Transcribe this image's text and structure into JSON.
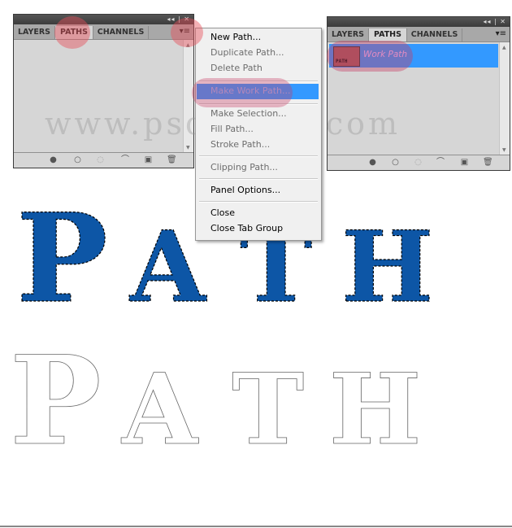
{
  "watermark": "www.psd-dude.com",
  "panel_left": {
    "window_controls": "◂◂ | ✕",
    "tabs": [
      {
        "label": "LAYERS",
        "active": false
      },
      {
        "label": "PATHS",
        "active": true
      },
      {
        "label": "CHANNELS",
        "active": false
      }
    ],
    "menu_icon": "▾≡",
    "footer_icons": [
      "fill-path-icon",
      "stroke-path-icon",
      "load-selection-icon",
      "make-work-path-icon",
      "new-path-icon",
      "delete-path-icon"
    ]
  },
  "context_menu": {
    "items": [
      {
        "label": "New Path...",
        "enabled": true
      },
      {
        "label": "Duplicate Path...",
        "enabled": false
      },
      {
        "label": "Delete Path",
        "enabled": false
      },
      {
        "label": "Make Work Path...",
        "enabled": false,
        "highlighted": true
      },
      {
        "label": "Make Selection...",
        "enabled": false
      },
      {
        "label": "Fill Path...",
        "enabled": false
      },
      {
        "label": "Stroke Path...",
        "enabled": false
      },
      {
        "label": "Clipping Path...",
        "enabled": false
      },
      {
        "label": "Panel Options...",
        "enabled": true
      },
      {
        "label": "Close",
        "enabled": true
      },
      {
        "label": "Close Tab Group",
        "enabled": true
      }
    ]
  },
  "panel_right": {
    "window_controls": "◂◂ | ✕",
    "tabs": [
      {
        "label": "LAYERS",
        "active": false
      },
      {
        "label": "PATHS",
        "active": true
      },
      {
        "label": "CHANNELS",
        "active": false
      }
    ],
    "menu_icon": "▾≡",
    "paths": [
      {
        "name": "Work Path",
        "thumbnail_text": "PATH",
        "selected": true
      }
    ]
  },
  "canvas": {
    "selection_text": "PATH",
    "outline_text": "PATH",
    "fill_color": "#0d56a6"
  }
}
